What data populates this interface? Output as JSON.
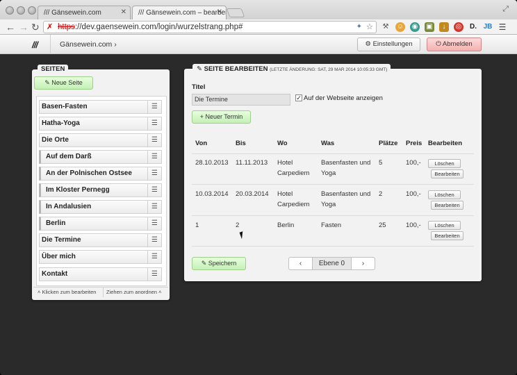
{
  "browser": {
    "tabs": [
      {
        "label": "/// Gänsewein.com"
      },
      {
        "label": "/// Gänsewein.com – bearbeit"
      }
    ],
    "url_scheme": "https",
    "url_rest": "://dev.gaensewein.com/login/wurzelstrang.php#"
  },
  "app": {
    "logo": "///",
    "breadcrumb": "Gänsewein.com",
    "settings_label": "Einstellungen",
    "logout_label": "Abmelden"
  },
  "sidebar": {
    "title": "SEITEN",
    "new_page_label": "Neue Seite",
    "items": [
      {
        "label": "Basen-Fasten"
      },
      {
        "label": "Hatha-Yoga"
      },
      {
        "label": "Die Orte"
      },
      {
        "label": "Auf dem Darß"
      },
      {
        "label": "An der Polnischen Ostsee"
      },
      {
        "label": "Im Kloster Pernegg"
      },
      {
        "label": "In Andalusien"
      },
      {
        "label": "Berlin"
      },
      {
        "label": "Die Termine"
      },
      {
        "label": "Über mich"
      },
      {
        "label": "Kontakt"
      }
    ],
    "footer_left": "Klicken zum bearbeiten",
    "footer_right": "Ziehen zum anordnen"
  },
  "editor": {
    "title": "SEITE BEARBEITEN",
    "last_change": "(LETZTE ÄNDERUNG: SAT, 29 MAR 2014 10:05:33 GMT)",
    "title_label": "Titel",
    "title_value": "Die Termine",
    "show_on_site_label": "Auf der Webseite anzeigen",
    "show_on_site": true,
    "new_date_label": "+ Neuer Termin",
    "columns": [
      "Von",
      "Bis",
      "Wo",
      "Was",
      "Plätze",
      "Preis",
      "Bearbeiten"
    ],
    "rows": [
      {
        "von": "28.10.2013",
        "bis": "11.11.2013",
        "wo1": "Hotel",
        "wo2": "Carpediem",
        "was1": "Basenfasten und",
        "was2": "Yoga",
        "plaetze": "5",
        "preis": "100,-"
      },
      {
        "von": "10.03.2014",
        "bis": "20.03.2014",
        "wo1": "Hotel",
        "wo2": "Carpediem",
        "was1": "Basenfasten und",
        "was2": "Yoga",
        "plaetze": "2",
        "preis": "100,-"
      },
      {
        "von": "1",
        "bis": "2",
        "wo1": "Berlin",
        "wo2": "",
        "was1": "Fasten",
        "was2": "",
        "plaetze": "25",
        "preis": "100,-"
      }
    ],
    "delete_label": "Löschen",
    "edit_label": "Bearbeiten",
    "save_label": "Speichern",
    "pager_prev": "‹",
    "pager_level": "Ebene 0",
    "pager_next": "›"
  }
}
